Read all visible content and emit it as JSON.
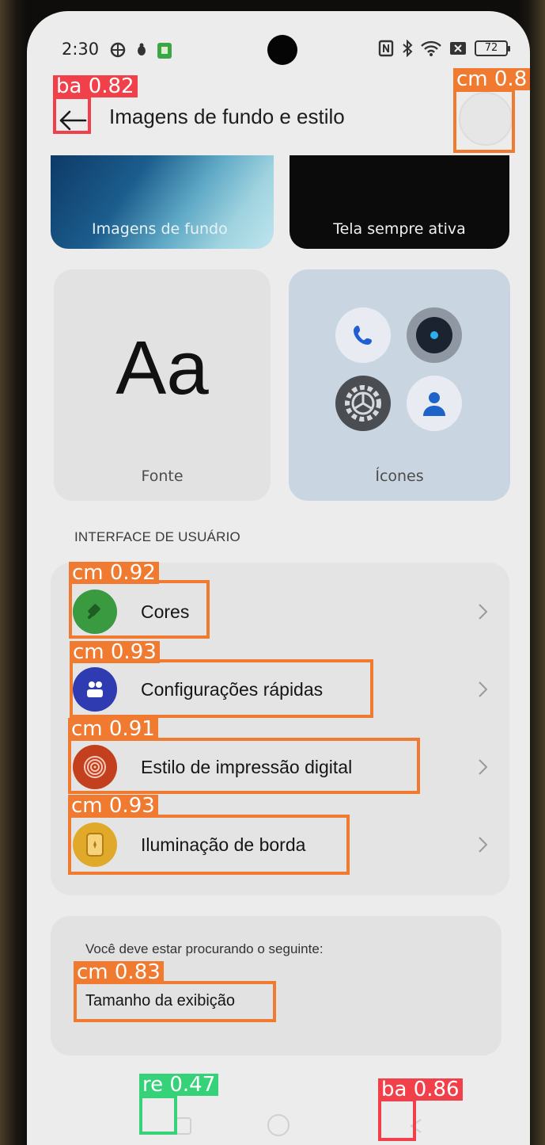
{
  "status_bar": {
    "time": "2:30",
    "battery": "72"
  },
  "header": {
    "title": "Imagens de fundo e estilo"
  },
  "cards": {
    "wallpaper_label": "Imagens de fundo",
    "aod_label": "Tela sempre ativa",
    "font_preview": "Aa",
    "font_label": "Fonte",
    "icons_label": "Ícones"
  },
  "section": {
    "title": "INTERFACE DE USUÁRIO",
    "items": [
      {
        "label": "Cores",
        "icon": "paint-brush-icon",
        "color": "#3a9a3f"
      },
      {
        "label": "Configurações rápidas",
        "icon": "quick-settings-icon",
        "color": "#2f3bb0"
      },
      {
        "label": "Estilo de impressão digital",
        "icon": "fingerprint-icon",
        "color": "#c2401e"
      },
      {
        "label": "Iluminação de borda",
        "icon": "edge-light-icon",
        "color": "#e0a92a"
      }
    ]
  },
  "suggestion": {
    "hint": "Você deve estar procurando o seguinte:",
    "link": "Tamanho da exibição"
  },
  "detections": {
    "back": "ba 0.82",
    "avatar": "cm 0.8",
    "cores": "cm 0.92",
    "quick": "cm 0.93",
    "fingerprint": "cm 0.91",
    "edge": "cm 0.93",
    "size": "cm 0.83",
    "recent": "re 0.47",
    "nav_back": "ba 0.86"
  }
}
